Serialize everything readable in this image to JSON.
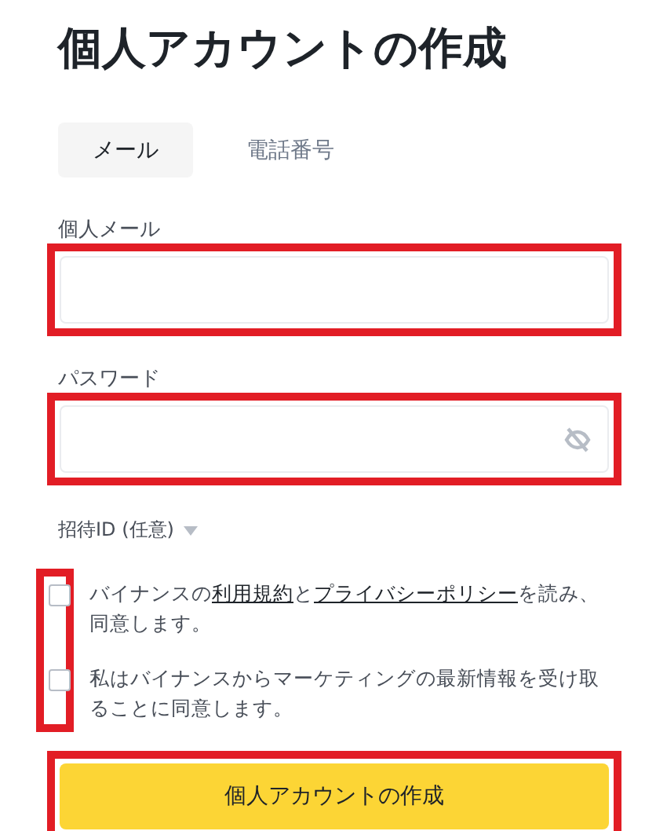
{
  "title": "個人アカウントの作成",
  "tabs": [
    {
      "label": "メール",
      "selected": true
    },
    {
      "label": "電話番号",
      "selected": false
    }
  ],
  "fields": [
    {
      "kind": "text",
      "label": "個人メール",
      "highlighted": true
    },
    {
      "kind": "password",
      "label": "パスワード",
      "highlighted": true
    }
  ],
  "referral": {
    "label": "招待ID (任意)",
    "expanded": false
  },
  "agreements": {
    "highlighted": true,
    "items": [
      {
        "checked": false,
        "parts": [
          {
            "text": "バイナンスの"
          },
          {
            "text": "利用規約",
            "link": true
          },
          {
            "text": "と"
          },
          {
            "text": "プライバシーポリシー",
            "link": true
          },
          {
            "text": "を読み、同意します。"
          }
        ]
      },
      {
        "checked": false,
        "parts": [
          {
            "text": "私はバイナンスからマーケティングの最新情報を受け取ることに同意します。"
          }
        ]
      }
    ]
  },
  "submit": {
    "label": "個人アカウントの作成",
    "highlighted": true
  }
}
